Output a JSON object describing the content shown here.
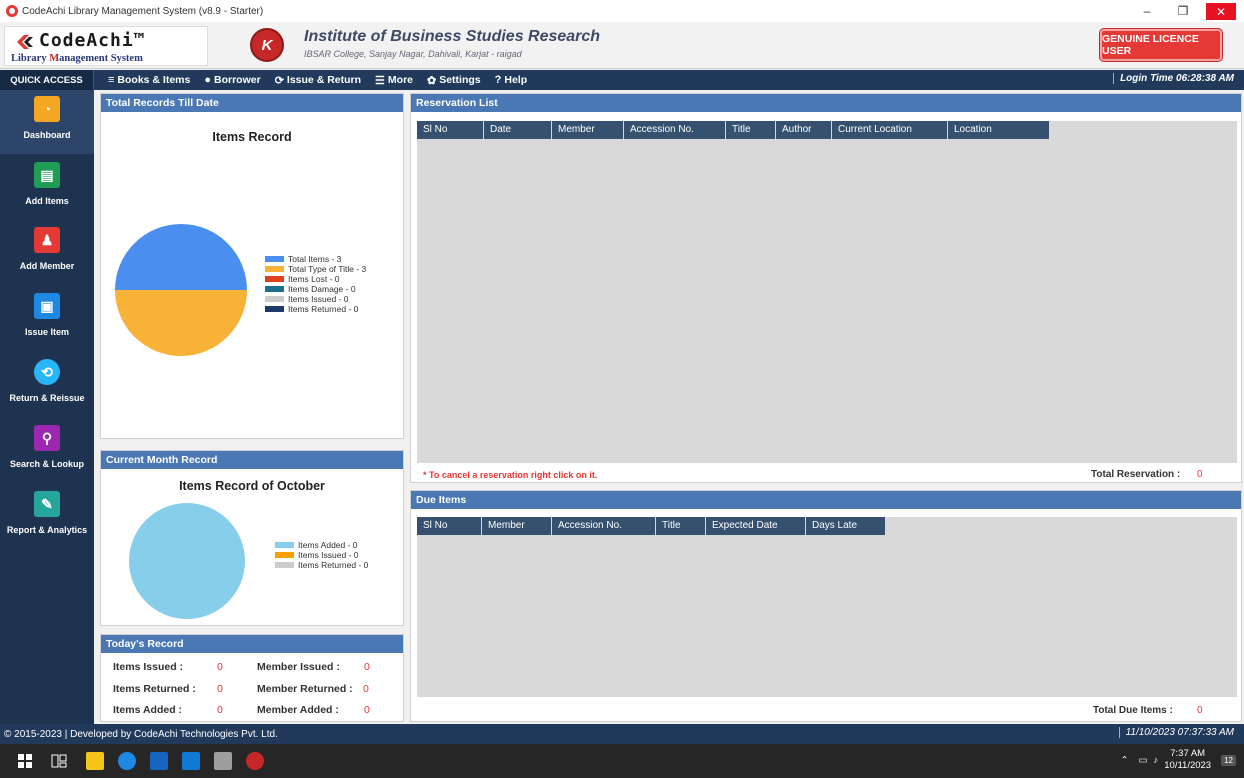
{
  "window": {
    "title": "CodeAchi Library Management System (v8.9 - Starter)",
    "minimize": "–",
    "maximize": "❐",
    "close": "✕"
  },
  "header": {
    "logo_main": "CodeAchi™",
    "logo_sub_1": "Library ",
    "logo_sub_2": "M",
    "logo_sub_3": "anagement System",
    "institute_name": "Institute of Business Studies Research",
    "institute_address": "IBSAR College, Sanjay Nagar, Dahivali, Karjat - raigad",
    "licence_button": "GENUINE LICENCE USER"
  },
  "menubar": {
    "quick_access": "QUICK ACCESS",
    "items": [
      {
        "icon": "≡",
        "label": "Books & Items"
      },
      {
        "icon": "●",
        "label": "Borrower"
      },
      {
        "icon": "⟳",
        "label": "Issue & Return"
      },
      {
        "icon": "☰",
        "label": "More"
      },
      {
        "icon": "✿",
        "label": "Settings"
      },
      {
        "icon": "?",
        "label": "Help"
      }
    ],
    "login_time": "Login Time 06:28:38 AM"
  },
  "sidebar": {
    "items": [
      {
        "label": "Dashboard",
        "icon": "◔",
        "color": "#f5a623"
      },
      {
        "label": "Add Items",
        "icon": "▤",
        "color": "#1f9d55"
      },
      {
        "label": "Add Member",
        "icon": "♟",
        "color": "#e53935"
      },
      {
        "label": "Issue Item",
        "icon": "▣",
        "color": "#1e88e5"
      },
      {
        "label": "Return & Reissue",
        "icon": "⟲",
        "color": "#29b6f6"
      },
      {
        "label": "Search & Lookup",
        "icon": "⚲",
        "color": "#9c27b0"
      },
      {
        "label": "Report & Analytics",
        "icon": "✎",
        "color": "#26a69a"
      }
    ]
  },
  "total_records": {
    "header": "Total Records Till Date",
    "chart_title": "Items Record"
  },
  "current_month": {
    "header": "Current Month Record",
    "chart_title": "Items Record of October"
  },
  "todays_record": {
    "header": "Today's Record",
    "items_issued_label": "Items Issued :",
    "items_issued": "0",
    "items_returned_label": "Items Returned :",
    "items_returned": "0",
    "items_added_label": "Items Added :",
    "items_added": "0",
    "member_issued_label": "Member Issued :",
    "member_issued": "0",
    "member_returned_label": "Member Returned :",
    "member_returned": "0",
    "member_added_label": "Member Added :",
    "member_added": "0"
  },
  "reservation": {
    "header": "Reservation List",
    "columns": [
      "Sl No",
      "Date",
      "Member",
      "Accession No.",
      "Title",
      "Author",
      "Current Location",
      "Location"
    ],
    "note": "* To cancel a reservation right click on it.",
    "total_label": "Total Reservation :",
    "total_value": "0"
  },
  "due_items": {
    "header": "Due Items",
    "columns": [
      "Sl No",
      "Member",
      "Accession No.",
      "Title",
      "Expected Date",
      "Days Late"
    ],
    "total_label": "Total Due Items :",
    "total_value": "0"
  },
  "footer": {
    "copyright": "© 2015-2023 | Developed by CodeAchi Technologies Pvt. Ltd.",
    "datetime": "11/10/2023 07:37:33 AM"
  },
  "taskbar": {
    "time": "7:37 AM",
    "date": "10/11/2023",
    "notification_count": "12"
  },
  "chart_data": [
    {
      "type": "pie",
      "title": "Items Record",
      "series": [
        {
          "name": "Total Items - 3",
          "value": 3,
          "color": "#4a8ff0"
        },
        {
          "name": "Total Type of Title - 3",
          "value": 3,
          "color": "#f8b238"
        },
        {
          "name": "Items Lost - 0",
          "value": 0,
          "color": "#e0401c"
        },
        {
          "name": "Items Damage - 0",
          "value": 0,
          "color": "#1f6e8c"
        },
        {
          "name": "Items Issued - 0",
          "value": 0,
          "color": "#cccccc"
        },
        {
          "name": "Items Returned - 0",
          "value": 0,
          "color": "#1e3a6a"
        }
      ],
      "legend": "right"
    },
    {
      "type": "pie",
      "title": "Items Record of October",
      "series": [
        {
          "name": "Items Added - 0",
          "value": 0,
          "color": "#87ceeb"
        },
        {
          "name": "Items Issued - 0",
          "value": 0,
          "color": "#f5a000"
        },
        {
          "name": "Items Returned - 0",
          "value": 0,
          "color": "#cccccc"
        }
      ],
      "empty_fill": "#87ceeb",
      "legend": "right"
    }
  ]
}
